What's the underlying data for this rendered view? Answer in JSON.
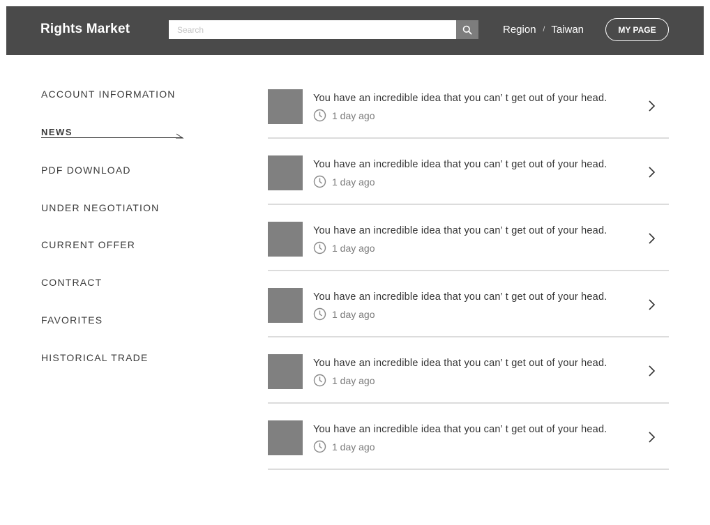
{
  "header": {
    "logo": "Rights Market",
    "search_placeholder": "Search",
    "region_label": "Region",
    "region_sep": "/",
    "region_value": "Taiwan",
    "mypage_label": "MY PAGE",
    "bg_color": "#4a4a4a"
  },
  "sidebar": {
    "items": [
      {
        "label": "ACCOUNT INFORMATION",
        "active": false
      },
      {
        "label": "NEWS",
        "active": true
      },
      {
        "label": "PDF DOWNLOAD",
        "active": false
      },
      {
        "label": "UNDER NEGOTIATION",
        "active": false
      },
      {
        "label": "CURRENT OFFER",
        "active": false
      },
      {
        "label": "CONTRACT",
        "active": false
      },
      {
        "label": "FAVORITES",
        "active": false
      },
      {
        "label": "HISTORICAL TRADE",
        "active": false
      }
    ]
  },
  "news": {
    "items": [
      {
        "title": "You have an incredible idea that you can’ t get out of your head.",
        "time": "1 day ago"
      },
      {
        "title": "You have an incredible idea that you can’ t get out of your head.",
        "time": "1 day ago"
      },
      {
        "title": "You have an incredible idea that you can’ t get out of your head.",
        "time": "1 day ago"
      },
      {
        "title": "You have an incredible idea that you can’ t get out of your head.",
        "time": "1 day ago"
      },
      {
        "title": "You have an incredible idea that you can’ t get out of your head.",
        "time": "1 day ago"
      },
      {
        "title": "You have an incredible idea that you can’ t get out of your head.",
        "time": "1 day ago"
      }
    ]
  },
  "icons": {
    "search": "search-icon",
    "clock": "clock-icon",
    "chevron": "chevron-right-icon",
    "arrow": "arrow-right-icon"
  }
}
